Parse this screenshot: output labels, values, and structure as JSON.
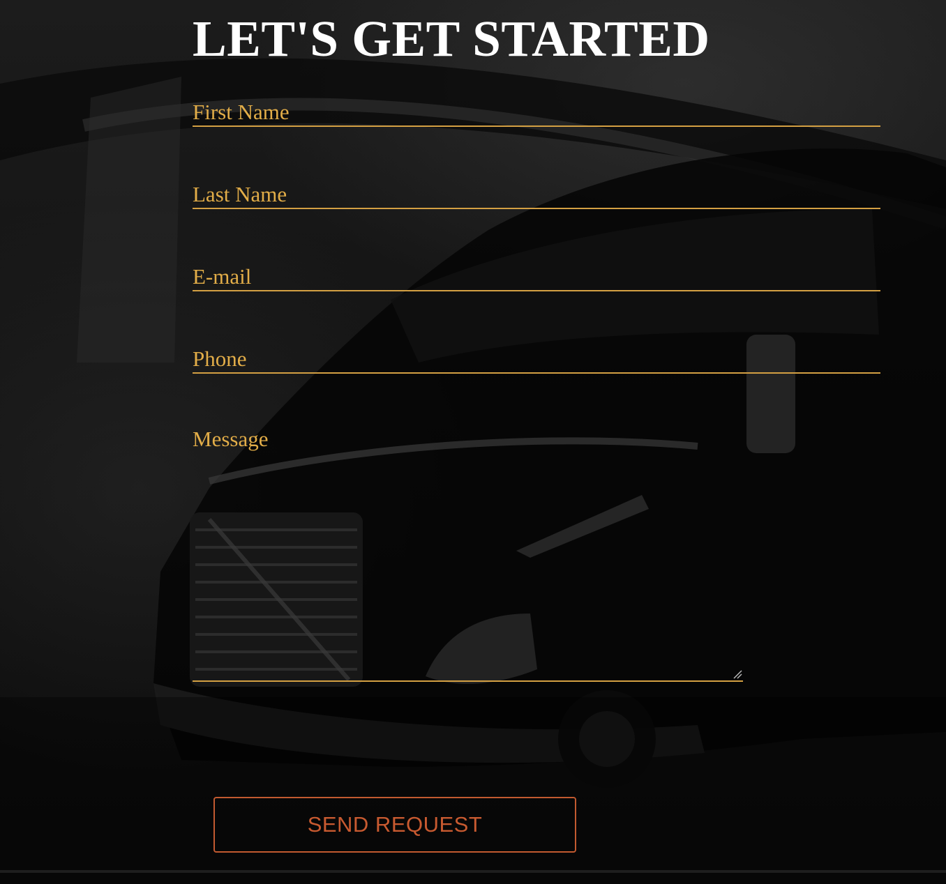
{
  "heading": "LET'S GET STARTED",
  "form": {
    "first_name_placeholder": "First Name",
    "last_name_placeholder": "Last Name",
    "email_placeholder": "E-mail",
    "phone_placeholder": "Phone",
    "message_placeholder": "Message",
    "submit_label": "SEND REQUEST"
  },
  "colors": {
    "label": "#e2ad48",
    "underline": "#d4a043",
    "button": "#c85a30",
    "heading": "#ffffff"
  },
  "background": {
    "image_subject": "truck-photo"
  }
}
